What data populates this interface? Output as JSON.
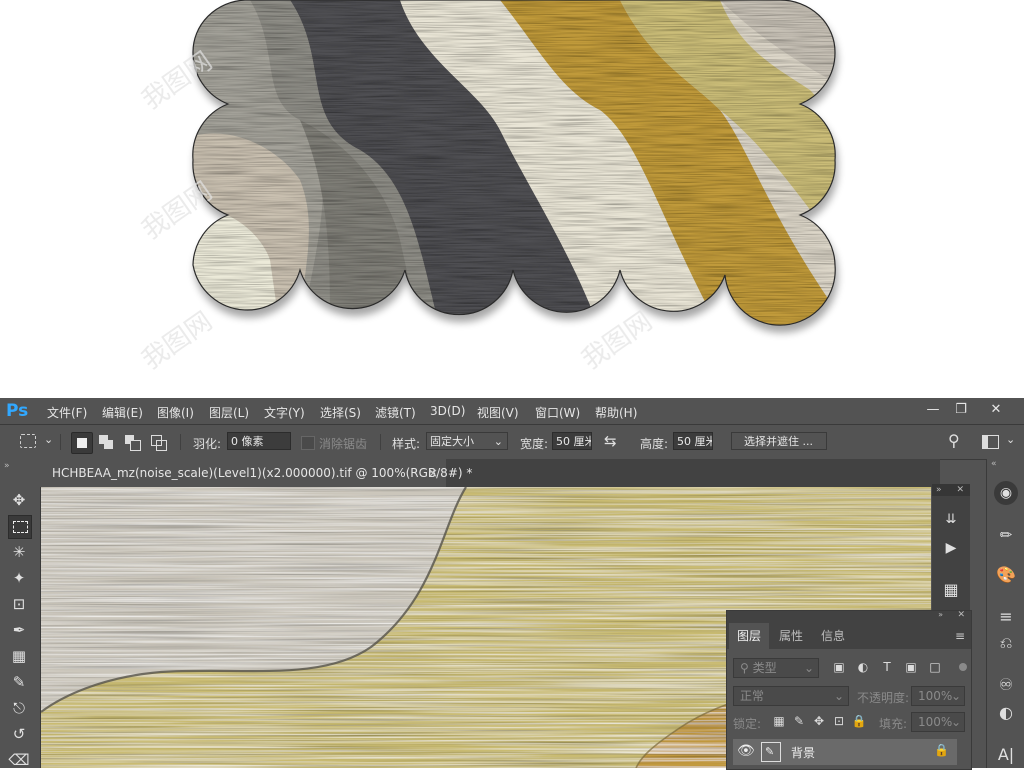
{
  "colors": {
    "accent": "#31a8ff",
    "chrome": "#535353",
    "chrome_dark": "#424242",
    "field": "#3c3c3c"
  },
  "menu": {
    "logo": "Ps",
    "items": [
      "文件(F)",
      "编辑(E)",
      "图像(I)",
      "图层(L)",
      "文字(Y)",
      "选择(S)",
      "滤镜(T)",
      "3D(D)",
      "视图(V)",
      "窗口(W)",
      "帮助(H)"
    ],
    "window_buttons": [
      "minimize-icon",
      "restore-icon",
      "close-icon"
    ]
  },
  "options": {
    "feather_label": "羽化:",
    "feather_value": "0 像素",
    "antialias_label": "消除锯齿",
    "style_label": "样式:",
    "style_value": "固定大小",
    "width_label": "宽度:",
    "width_value": "50 厘米",
    "height_label": "高度:",
    "height_value": "50 厘米",
    "select_mask_button": "选择并遮住 ..."
  },
  "document": {
    "tab_title": "HCHBEAA_mz(noise_scale)(Level1)(x2.000000).tif @ 100%(RGB/8#) *",
    "tab_close": "×"
  },
  "tools": [
    "move-tool",
    "rect-marquee-tool",
    "lasso-tool",
    "magic-wand-tool",
    "crop-tool",
    "eyedropper-tool",
    "healing-brush-tool",
    "brush-tool",
    "clone-stamp-tool",
    "history-brush-tool",
    "eraser-tool"
  ],
  "layers_panel": {
    "tabs": [
      "图层",
      "属性",
      "信息"
    ],
    "active_tab": "图层",
    "filter_label": "类型",
    "blend_mode": "正常",
    "opacity_label": "不透明度:",
    "opacity_value": "100%",
    "lock_label": "锁定:",
    "fill_label": "填充:",
    "fill_value": "100%",
    "layers": [
      {
        "name": "背景",
        "visible": true,
        "locked": true
      }
    ]
  },
  "watermark": "我图网"
}
